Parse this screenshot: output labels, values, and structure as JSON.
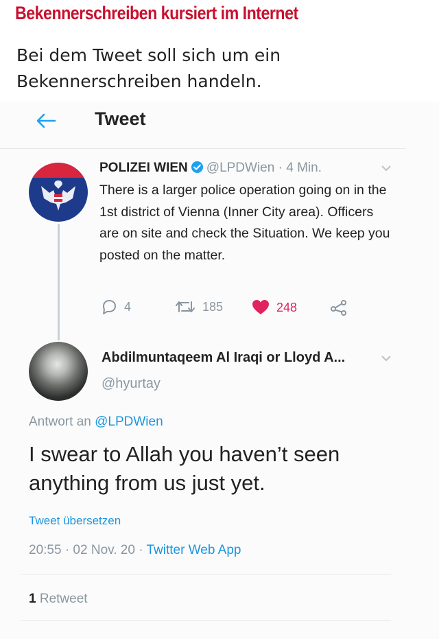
{
  "article": {
    "headline": "Bekennerschreiben kursiert im Internet",
    "lead": "Bei dem Tweet soll sich um ein Bekennerschreiben handeln."
  },
  "twitter_header": {
    "title": "Tweet",
    "back_icon": "arrow-left-icon"
  },
  "police_tweet": {
    "name": "POLIZEI WIEN",
    "handle": "@LPDWien",
    "separator": "·",
    "time": "4 Min.",
    "text": "There is a larger police operation going on in the 1st district of Vienna (Inner City area). Officers are on site and check the Situation. We keep you posted on the matter.",
    "replies": "4",
    "retweets": "185",
    "likes": "248"
  },
  "reply_tweet": {
    "name": "Abdilmuntaqeem Al Iraqi or Lloyd A...",
    "handle": "@hyurtay",
    "reply_prefix": "Antwort an",
    "reply_to": "@LPDWien",
    "text": "I swear to Allah you haven’t seen anything from us just yet.",
    "translate": "Tweet übersetzen",
    "timestamp": "20:55 · 02 Nov. 20 ·",
    "source": "Twitter Web App",
    "retweet_count": "1",
    "retweet_label": "Retweet"
  },
  "colors": {
    "headline": "#c8102e",
    "link": "#1b95e0",
    "like": "#e0245e",
    "muted": "#8a96a0"
  }
}
